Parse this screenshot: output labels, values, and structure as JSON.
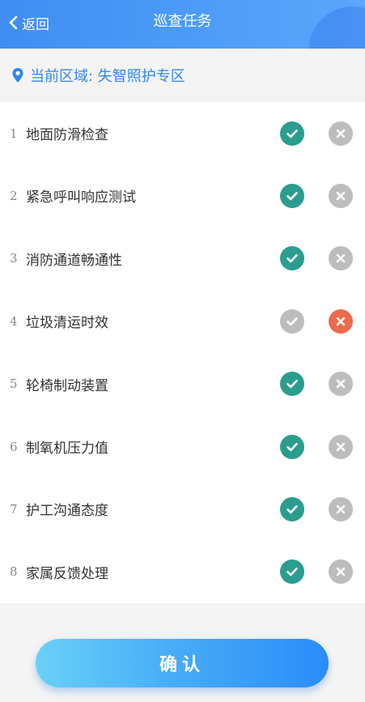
{
  "header": {
    "back_label": "返回",
    "title": "巡查任务"
  },
  "area": {
    "label": "当前区域: 失智照护专区",
    "icon": "location-pin-icon"
  },
  "colors": {
    "accent": "#2f87ee",
    "pass": "#2a9d8f",
    "fail": "#ec6b4c",
    "inactive": "#bdbdbd"
  },
  "tasks": [
    {
      "num": "1",
      "name": "地面防滑检查",
      "status": "pass"
    },
    {
      "num": "2",
      "name": "紧急呼叫响应测试",
      "status": "pass"
    },
    {
      "num": "3",
      "name": "消防通道畅通性",
      "status": "pass"
    },
    {
      "num": "4",
      "name": "垃圾清运时效",
      "status": "fail"
    },
    {
      "num": "5",
      "name": "轮椅制动装置",
      "status": "pass"
    },
    {
      "num": "6",
      "name": "制氧机压力值",
      "status": "pass"
    },
    {
      "num": "7",
      "name": "护工沟通态度",
      "status": "pass"
    },
    {
      "num": "8",
      "name": "家属反馈处理",
      "status": "pass"
    }
  ],
  "confirm_label": "确认"
}
